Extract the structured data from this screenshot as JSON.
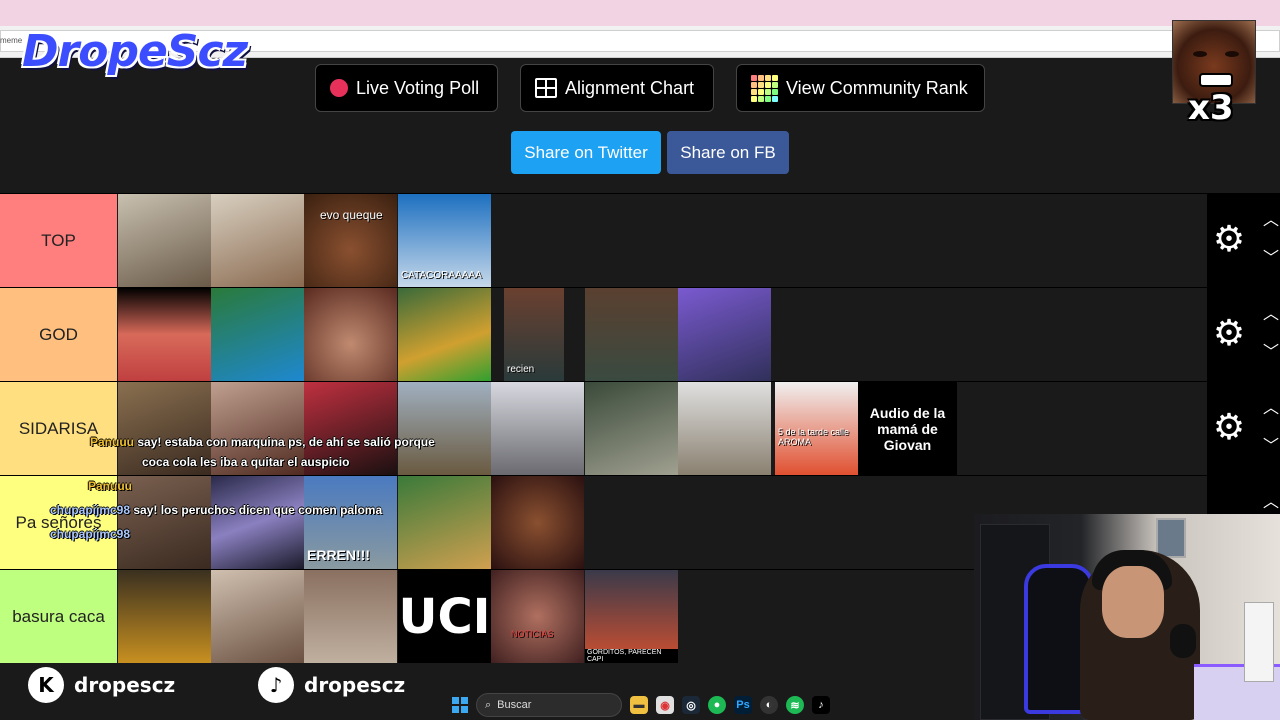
{
  "browser": {
    "url_fragment": "meme"
  },
  "overlay": {
    "logo_text": "DropeScz",
    "multiplier": "x3"
  },
  "toolbar": {
    "live_voting_label": "Live Voting Poll",
    "alignment_label": "Alignment Chart",
    "community_rank_label": "View Community Rank",
    "share_twitter_label": "Share on Twitter",
    "share_fb_label": "Share on FB"
  },
  "tiers": [
    {
      "label": "TOP",
      "color": "#ff7f7f",
      "items": [
        {
          "caption": ""
        },
        {
          "caption": ""
        },
        {
          "caption": "evo queque"
        },
        {
          "caption": "CATACORAAAAA"
        }
      ]
    },
    {
      "label": "GOD",
      "color": "#ffbf7f",
      "items": [
        {
          "caption": ""
        },
        {
          "caption": ""
        },
        {
          "caption": ""
        },
        {
          "caption": ""
        },
        {
          "caption": "recien"
        },
        {
          "caption": ""
        },
        {
          "caption": ""
        }
      ]
    },
    {
      "label": "SIDARISA",
      "color": "#ffdf7f",
      "items": [
        {
          "caption": ""
        },
        {
          "caption": ""
        },
        {
          "caption": ""
        },
        {
          "caption": ""
        },
        {
          "caption": ""
        },
        {
          "caption": ""
        },
        {
          "caption": ""
        },
        {
          "caption": "5 de la tarde calle AROMA"
        },
        {
          "caption": "Audio de la mamá de Giovan"
        }
      ]
    },
    {
      "label": "Pa señores",
      "color": "#ffff7f",
      "items": [
        {
          "caption": ""
        },
        {
          "caption": ""
        },
        {
          "caption": "ERREN!!!"
        },
        {
          "caption": ""
        },
        {
          "caption": ""
        }
      ]
    },
    {
      "label": "basura caca",
      "color": "#bfff7f",
      "items": [
        {
          "caption": ""
        },
        {
          "caption": ""
        },
        {
          "caption": ""
        },
        {
          "caption": "UCI"
        },
        {
          "caption": "NOTICIAS"
        },
        {
          "caption": "GORDITOS, PARECEN CAPI"
        }
      ]
    }
  ],
  "chat": [
    {
      "user": "Panuuu",
      "message": "say! estaba con marquina ps, de ahí se salió porque coca cola les iba a quitar el auspicio"
    },
    {
      "user": "Panuuu",
      "message": ""
    },
    {
      "user": "chupapijmc98",
      "message": "say! los peruchos dicen que comen paloma"
    },
    {
      "user": "chupapijmc98",
      "message": ""
    }
  ],
  "chat_line2": "coca cola les iba a quitar el auspicio",
  "chat_line1": "say! estaba con marquina ps, de ahí se salió porque",
  "social": {
    "kick_handle": "dropescz",
    "tiktok_handle": "dropescz"
  },
  "taskbar": {
    "search_placeholder": "Buscar"
  },
  "colors": {
    "twitter": "#1da1f2",
    "facebook": "#3b5998",
    "rec_dot": "#e8315a"
  }
}
